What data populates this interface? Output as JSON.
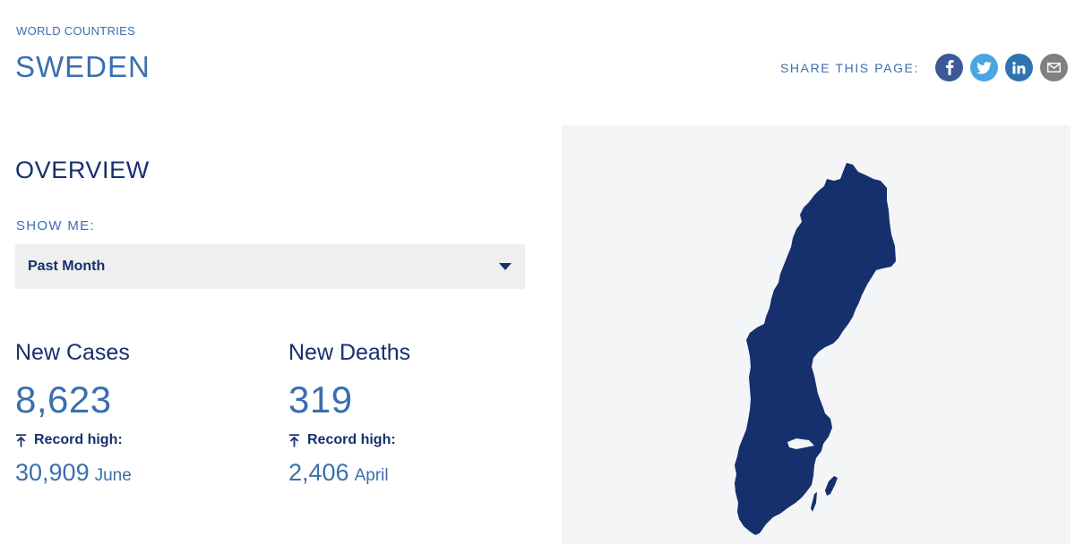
{
  "header": {
    "breadcrumb": "WORLD COUNTRIES",
    "title": "SWEDEN"
  },
  "share": {
    "label": "SHARE THIS PAGE:",
    "buttons": [
      {
        "name": "facebook",
        "icon": "facebook-icon",
        "color": "#3b5998"
      },
      {
        "name": "twitter",
        "icon": "twitter-icon",
        "color": "#4aa6e3"
      },
      {
        "name": "linkedin",
        "icon": "linkedin-icon",
        "color": "#2f73b3"
      },
      {
        "name": "email",
        "icon": "mail-icon",
        "color": "#808080"
      }
    ]
  },
  "overview": {
    "title": "OVERVIEW",
    "show_me_label": "SHOW ME:",
    "period": "Past Month"
  },
  "stats": {
    "cases": {
      "label": "New Cases",
      "value": "8,623",
      "record_label": "Record high:",
      "record_value": "30,909",
      "record_month": "June"
    },
    "deaths": {
      "label": "New Deaths",
      "value": "319",
      "record_label": "Record high:",
      "record_value": "2,406",
      "record_month": "April"
    }
  },
  "map": {
    "country": "Sweden",
    "fill_color": "#16306e",
    "background_color": "#f4f5f7"
  },
  "colors": {
    "accent": "#3a6fae",
    "dark": "#16306e"
  }
}
